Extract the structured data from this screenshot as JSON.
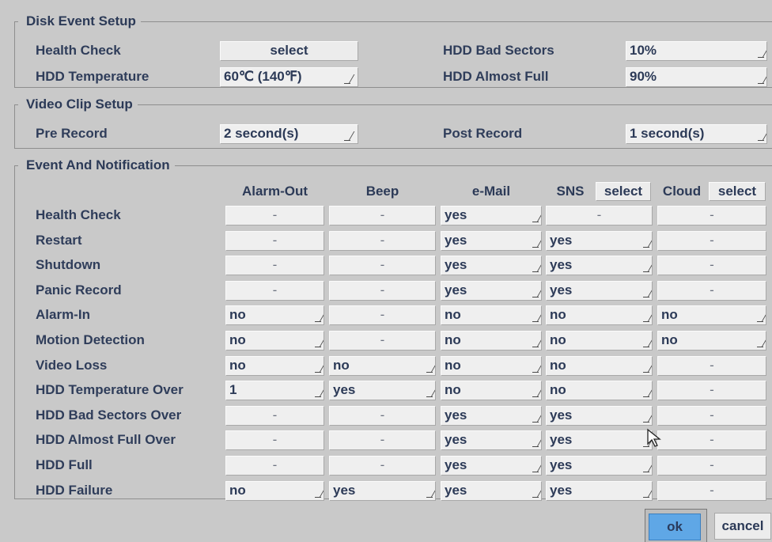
{
  "disk_setup": {
    "title": "Disk Event Setup",
    "health_check_label": "Health Check",
    "health_check_button": "select",
    "hdd_temperature_label": "HDD Temperature",
    "hdd_temperature_value": "60℃ (140℉)",
    "hdd_bad_sectors_label": "HDD Bad Sectors",
    "hdd_bad_sectors_value": "10%",
    "hdd_almost_full_label": "HDD Almost Full",
    "hdd_almost_full_value": "90%"
  },
  "video_setup": {
    "title": "Video Clip Setup",
    "pre_record_label": "Pre Record",
    "pre_record_value": "2 second(s)",
    "post_record_label": "Post Record",
    "post_record_value": "1 second(s)"
  },
  "notification": {
    "title": "Event And Notification",
    "columns": {
      "alarm_out": "Alarm-Out",
      "beep": "Beep",
      "email": "e-Mail",
      "sns": "SNS",
      "sns_select": "select",
      "cloud": "Cloud",
      "cloud_select": "select"
    },
    "rows": [
      {
        "label": "Health Check",
        "cells": [
          "-",
          "-",
          "yes",
          "-",
          "-"
        ]
      },
      {
        "label": "Restart",
        "cells": [
          "-",
          "-",
          "yes",
          "yes",
          "-"
        ]
      },
      {
        "label": "Shutdown",
        "cells": [
          "-",
          "-",
          "yes",
          "yes",
          "-"
        ]
      },
      {
        "label": "Panic Record",
        "cells": [
          "-",
          "-",
          "yes",
          "yes",
          "-"
        ]
      },
      {
        "label": "Alarm-In",
        "cells": [
          "no",
          "-",
          "no",
          "no",
          "no"
        ]
      },
      {
        "label": "Motion Detection",
        "cells": [
          "no",
          "-",
          "no",
          "no",
          "no"
        ]
      },
      {
        "label": "Video Loss",
        "cells": [
          "no",
          "no",
          "no",
          "no",
          "-"
        ]
      },
      {
        "label": "HDD Temperature Over",
        "cells": [
          "1",
          "yes",
          "no",
          "no",
          "-"
        ]
      },
      {
        "label": "HDD Bad Sectors Over",
        "cells": [
          "-",
          "-",
          "yes",
          "yes",
          "-"
        ]
      },
      {
        "label": "HDD Almost Full Over",
        "cells": [
          "-",
          "-",
          "yes",
          "yes",
          "-"
        ]
      },
      {
        "label": "HDD Full",
        "cells": [
          "-",
          "-",
          "yes",
          "yes",
          "-"
        ]
      },
      {
        "label": "HDD Failure",
        "cells": [
          "no",
          "yes",
          "yes",
          "yes",
          "-"
        ]
      }
    ]
  },
  "buttons": {
    "ok": "ok",
    "cancel": "cancel"
  },
  "colors": {
    "background": "#c9c9c9",
    "field": "#efefef",
    "text": "#2c3a57",
    "ok_button": "#5fa7e6"
  }
}
